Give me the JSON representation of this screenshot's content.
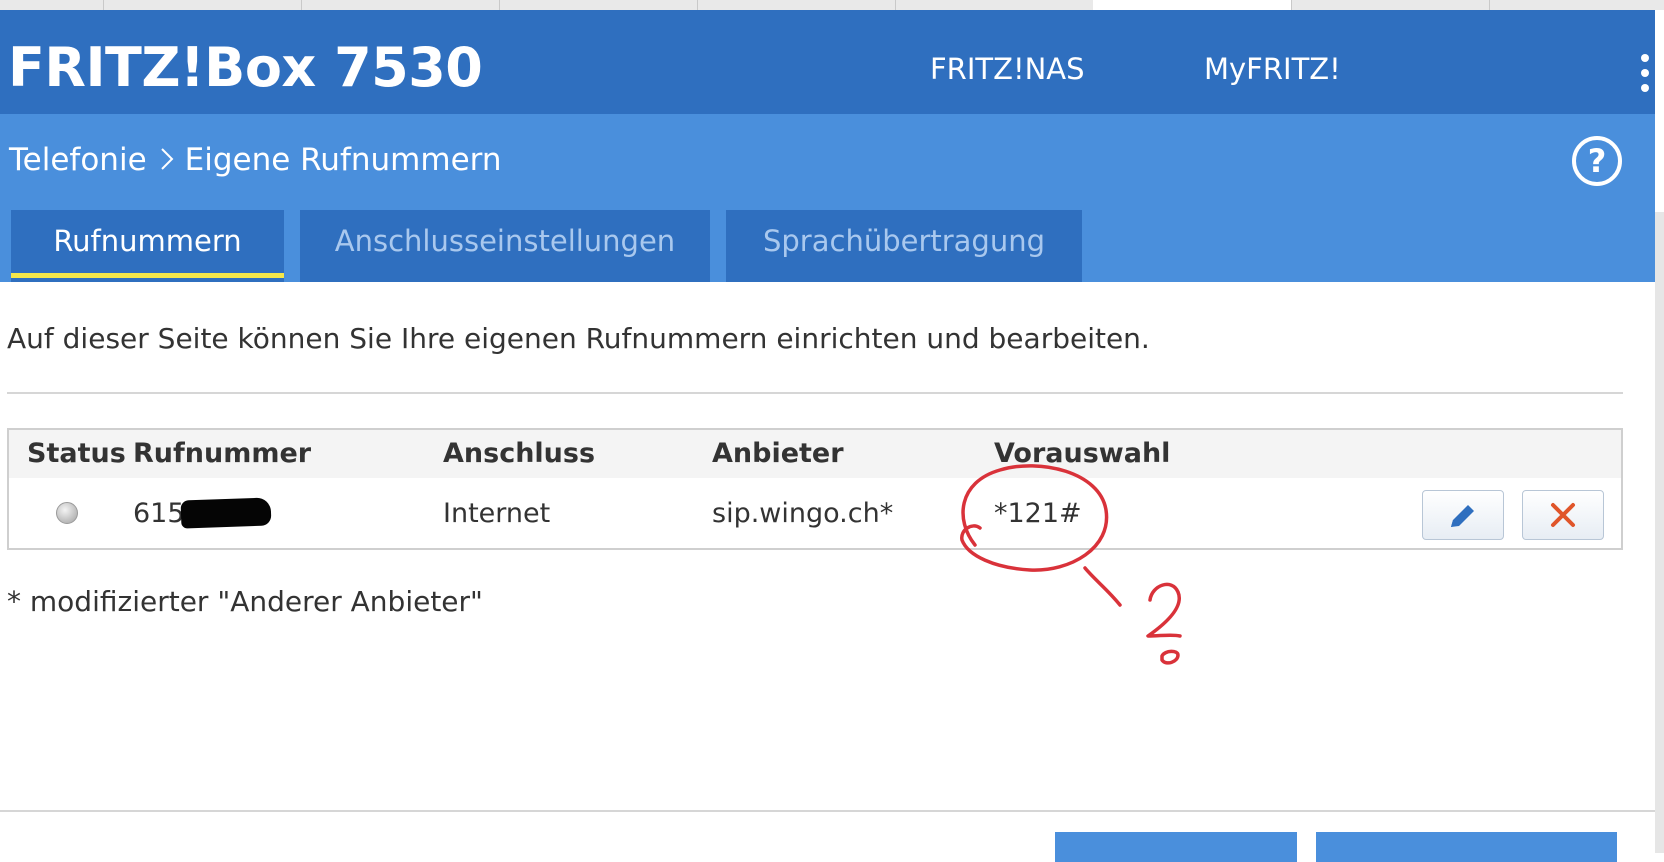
{
  "header": {
    "brand": "FRITZ!Box 7530",
    "nav": [
      {
        "label": "FRITZ!NAS"
      },
      {
        "label": "MyFRITZ!"
      }
    ]
  },
  "breadcrumb": {
    "parent": "Telefonie",
    "current": "Eigene Rufnummern"
  },
  "help_label": "?",
  "tabs": [
    {
      "label": "Rufnummern",
      "active": true
    },
    {
      "label": "Anschlusseinstellungen",
      "active": false
    },
    {
      "label": "Sprachübertragung",
      "active": false
    }
  ],
  "intro": "Auf dieser Seite können Sie Ihre eigenen Rufnummern einrichten und bearbeiten.",
  "table": {
    "columns": [
      "Status",
      "Rufnummer",
      "Anschluss",
      "Anbieter",
      "Vorauswahl"
    ],
    "rows": [
      {
        "status": "inactive",
        "rufnummer_visible": "615",
        "anschluss": "Internet",
        "anbieter": "sip.wingo.ch*",
        "vorauswahl": "*121#"
      }
    ]
  },
  "footnote": "* modifizierter \"Anderer Anbieter\"",
  "colors": {
    "header": "#2f6fbf",
    "subheader": "#4a8fdc",
    "tab_indicator": "#f5e74a",
    "delete": "#e0552a",
    "edit": "#2f6fbf",
    "annotation": "#d9323a"
  },
  "icons": {
    "edit": "pencil-icon",
    "delete": "close-icon",
    "breadcrumb_separator": "chevron-right-icon",
    "menu": "kebab-menu-icon",
    "help": "help-circle-icon"
  }
}
